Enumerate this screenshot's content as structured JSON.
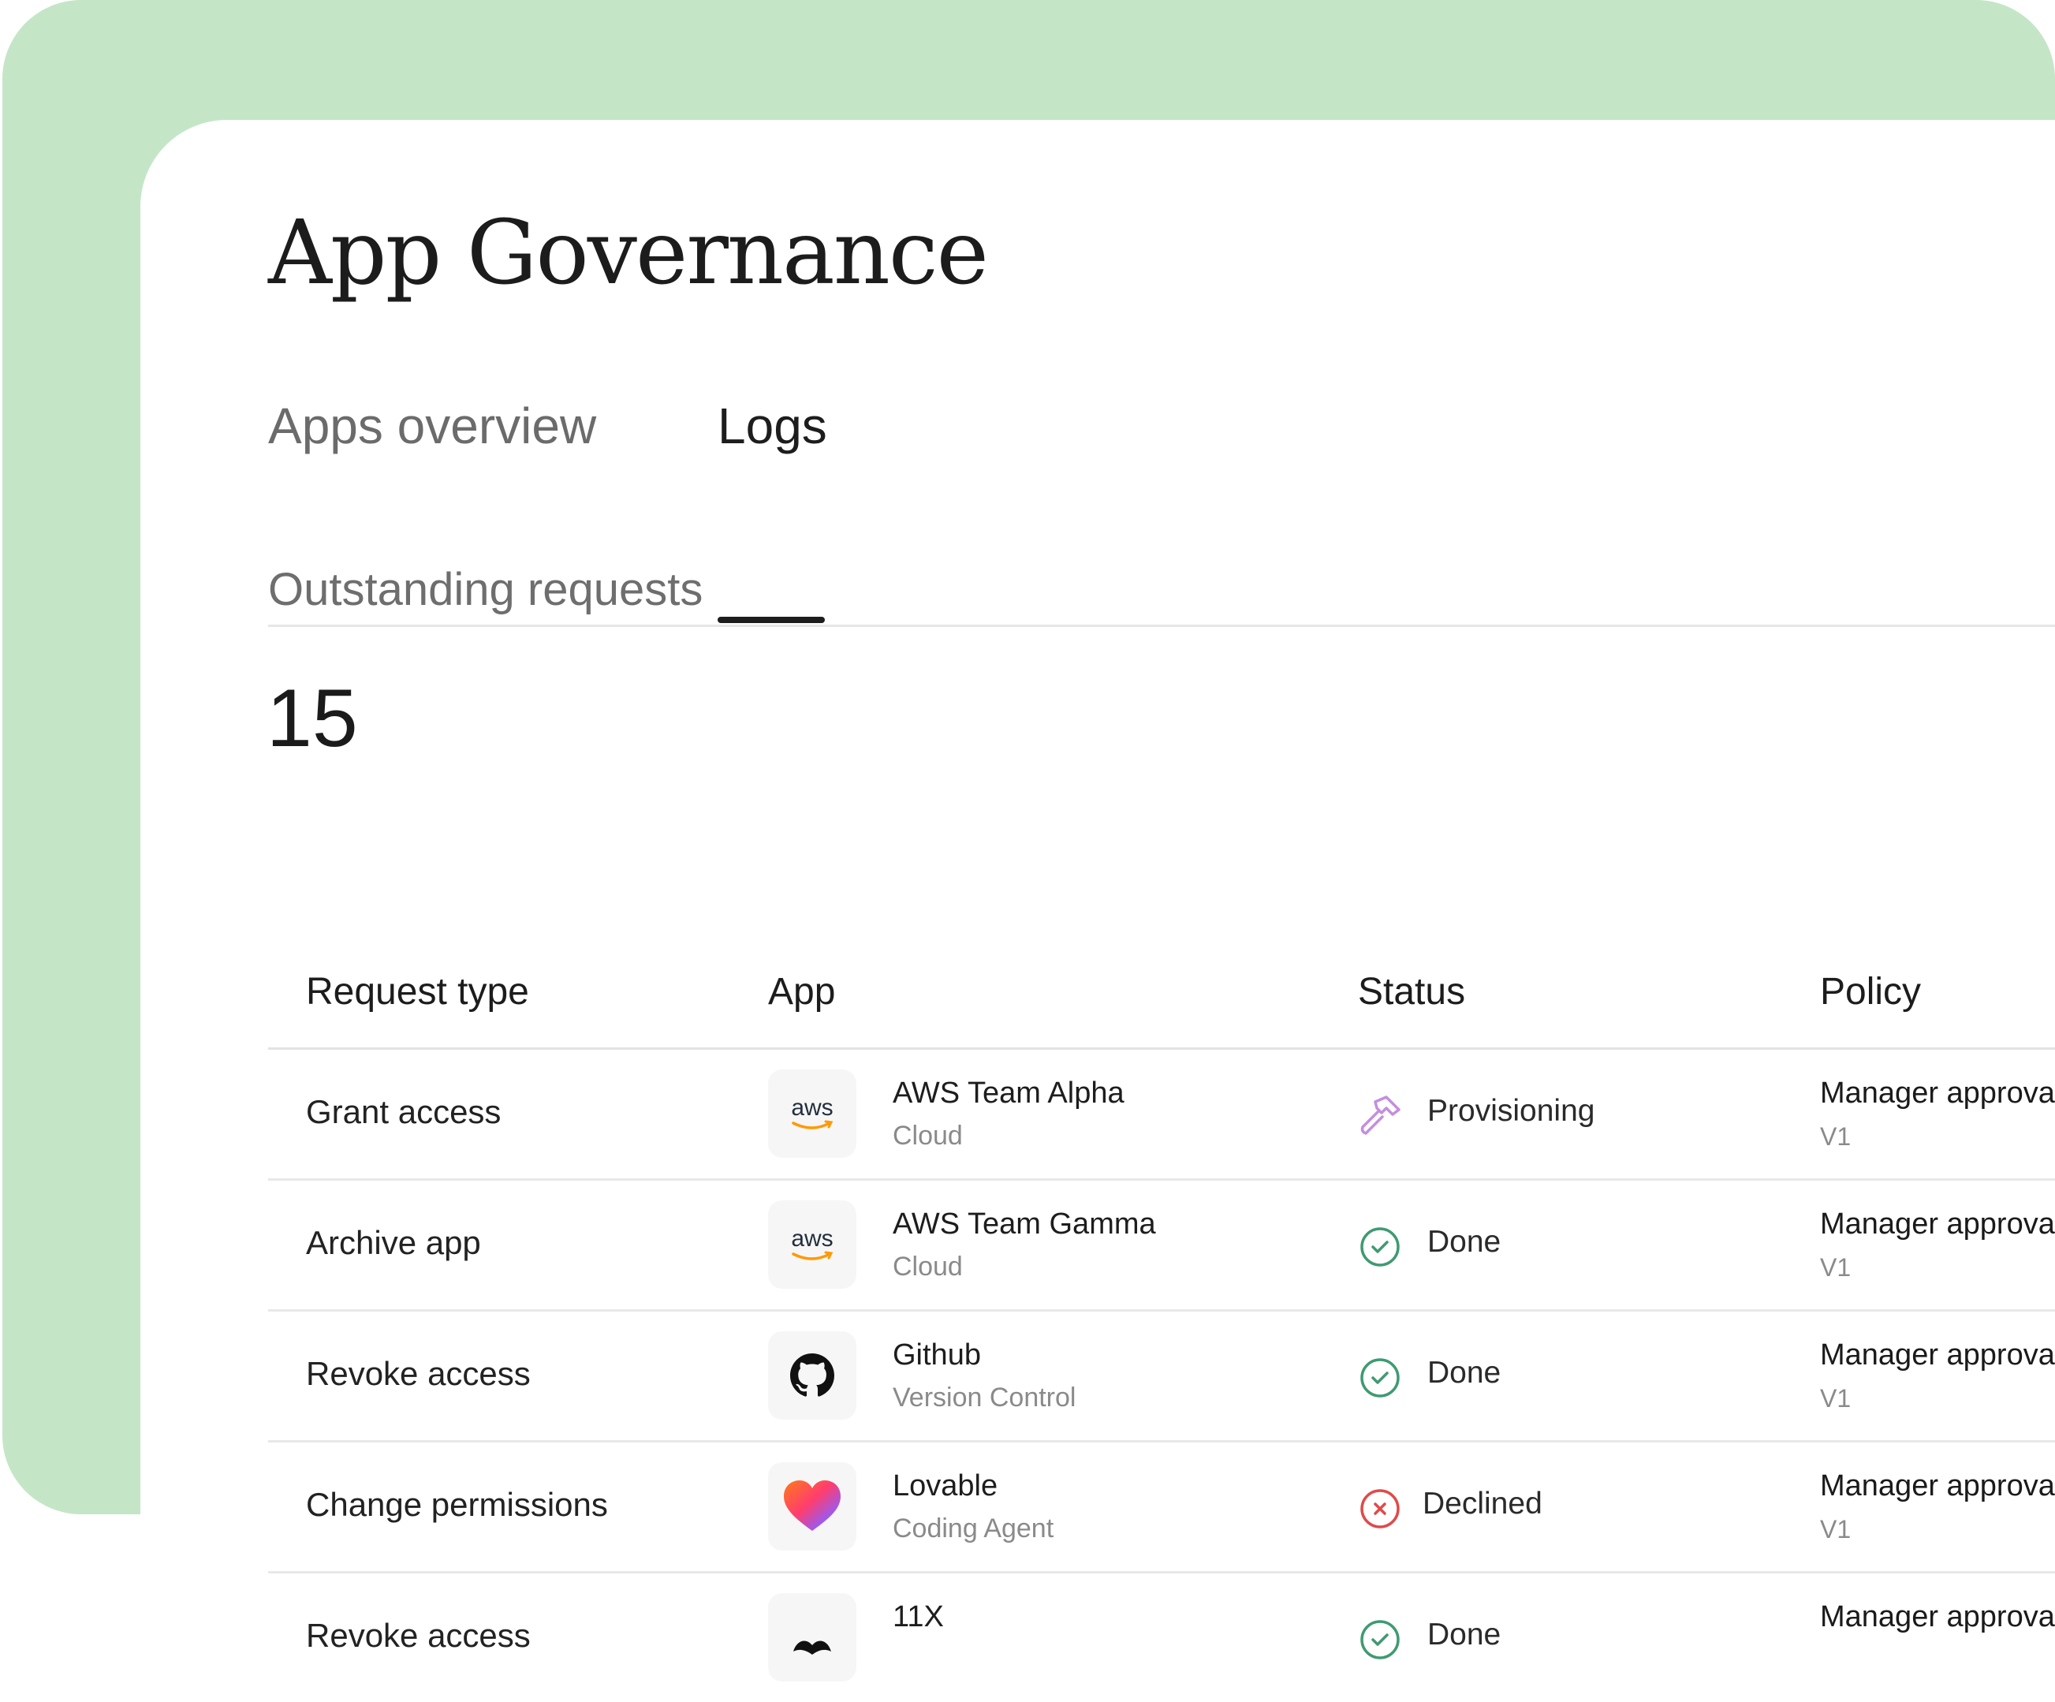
{
  "page": {
    "title": "App Governance"
  },
  "tabs": [
    {
      "label": "Apps overview",
      "active": false
    },
    {
      "label": "Logs",
      "active": true
    }
  ],
  "summary": {
    "label": "Outstanding requests",
    "value": "15"
  },
  "table": {
    "headers": [
      "Request type",
      "App",
      "Status",
      "Policy"
    ],
    "rows": [
      {
        "request_type": "Grant access",
        "app_name": "AWS Team Alpha",
        "app_category": "Cloud",
        "app_logo": "aws-logo",
        "logo_text": "aws",
        "status": "Provisioning",
        "status_icon": "hammer-icon",
        "policy": "Manager approval",
        "policy_version": "V1"
      },
      {
        "request_type": "Archive app",
        "app_name": "AWS Team Gamma",
        "app_category": "Cloud",
        "app_logo": "aws-logo",
        "logo_text": "aws",
        "status": "Done",
        "status_icon": "check-circle-icon",
        "policy": "Manager approval",
        "policy_version": "V1"
      },
      {
        "request_type": "Revoke access",
        "app_name": "Github",
        "app_category": "Version Control",
        "app_logo": "github-logo",
        "status": "Done",
        "status_icon": "check-circle-icon",
        "policy": "Manager approval",
        "policy_version": "V1"
      },
      {
        "request_type": "Change permissions",
        "app_name": "Lovable",
        "app_category": "Coding Agent",
        "app_logo": "lovable-heart-logo",
        "status": "Declined",
        "status_icon": "x-circle-icon",
        "policy": "Manager approval",
        "policy_version": "V1"
      },
      {
        "request_type": "Revoke access",
        "app_name": "11X",
        "app_category": "",
        "app_logo": "11x-logo",
        "status": "Done",
        "status_icon": "check-circle-icon",
        "policy": "Manager approval",
        "policy_version": ""
      }
    ]
  },
  "colors": {
    "frame_bg": "#c4e6c7",
    "provisioning": "#c48ee0",
    "done": "#3f9a72",
    "declined": "#e04a4a"
  }
}
